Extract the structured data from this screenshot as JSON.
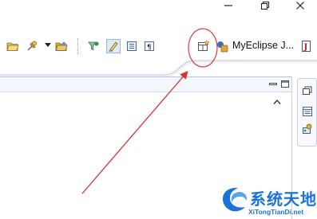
{
  "window": {
    "controls": [
      "minimize-icon",
      "restore-icon",
      "close-icon"
    ]
  },
  "toolbar": {
    "left_group": [
      "open-folder-icon",
      "pin-icon",
      "dropdown-icon",
      "open-type-icon"
    ],
    "right_group": [
      "filter-icon",
      "highlight-icon",
      "outline-icon",
      "paragraph-icon"
    ],
    "pressed_tool": "highlight-icon"
  },
  "perspective": {
    "open_perspective_icon": "open-perspective-icon",
    "label": "MyEclipse J...",
    "icon": "myeclipse-perspective-icon",
    "java_icon": "java-perspective-icon"
  },
  "editor": {
    "controls": [
      "minimize-icon",
      "maximize-icon"
    ],
    "scroll_icon": "scroll-up-icon"
  },
  "trim": {
    "icons": [
      "restore-view-icon",
      "list-view-icon",
      "servers-icon"
    ]
  },
  "watermark": {
    "title": "系统天地",
    "url": "XiTongTianDi.net"
  },
  "annotation": {
    "circle_color": "#e23b3b",
    "arrow_color": "#d63333"
  }
}
